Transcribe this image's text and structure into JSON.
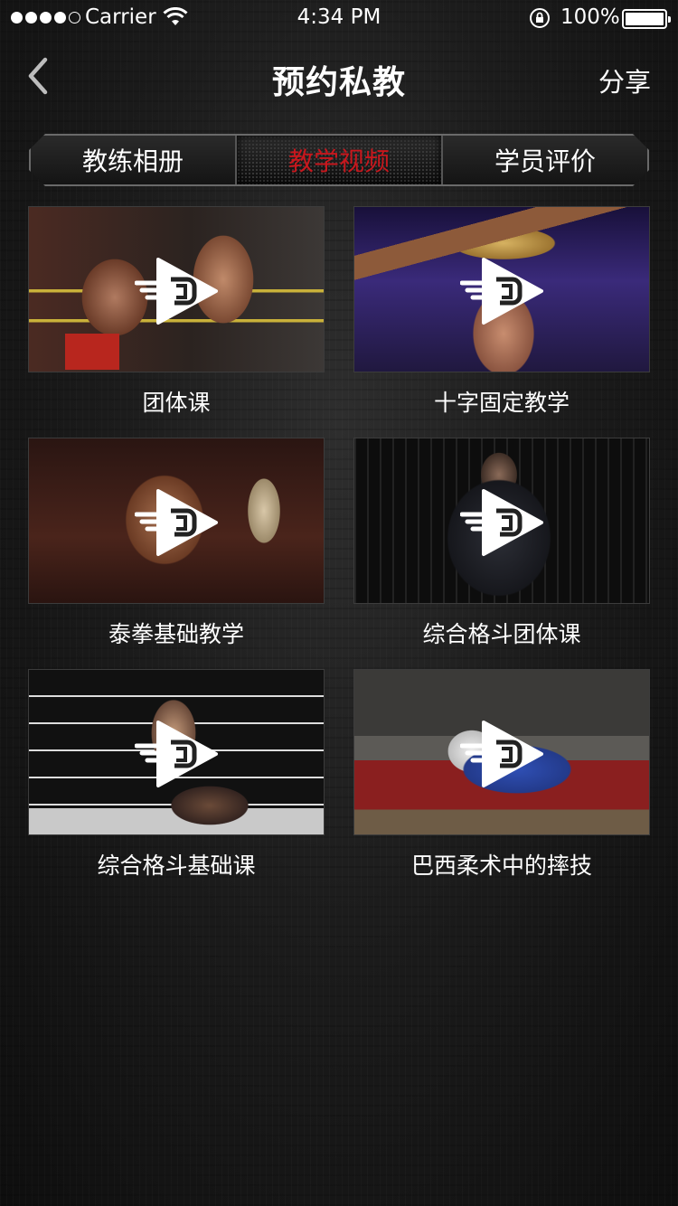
{
  "status_bar": {
    "carrier": "Carrier",
    "time": "4:34 PM",
    "battery": "100%"
  },
  "nav": {
    "title": "预约私教",
    "share": "分享"
  },
  "tabs": [
    {
      "label": "教练相册",
      "active": false
    },
    {
      "label": "教学视频",
      "active": true
    },
    {
      "label": "学员评价",
      "active": false
    }
  ],
  "videos": [
    {
      "title": "团体课"
    },
    {
      "title": "十字固定教学"
    },
    {
      "title": "泰拳基础教学"
    },
    {
      "title": "综合格斗团体课"
    },
    {
      "title": "综合格斗基础课"
    },
    {
      "title": "巴西柔术中的摔技"
    }
  ],
  "colors": {
    "active_tab": "#c8171d",
    "background": "#1c1c1c"
  },
  "icons": {
    "back": "chevron-left-icon",
    "play": "play-icon"
  }
}
